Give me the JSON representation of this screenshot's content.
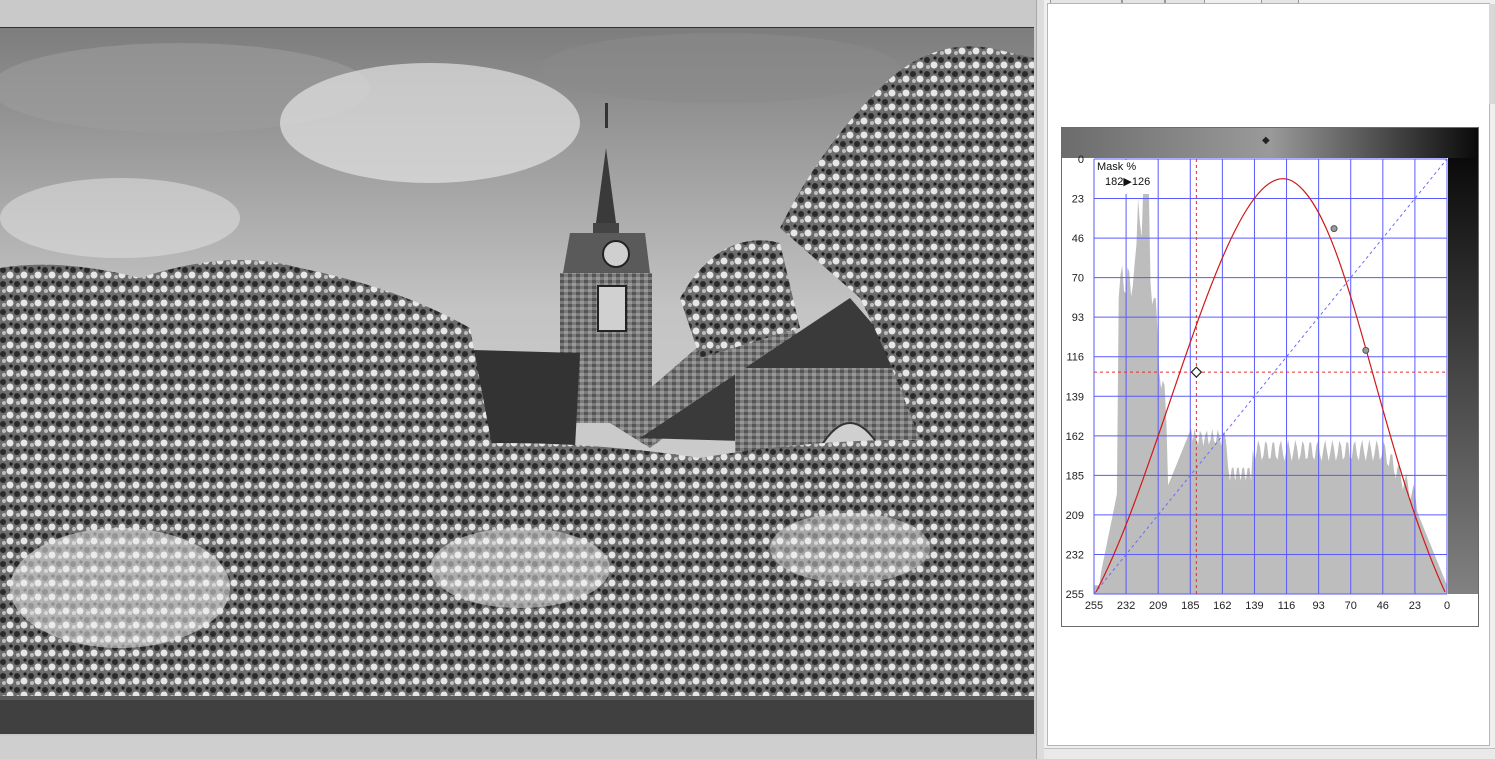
{
  "curves": {
    "mask_label": "Mask",
    "percent_label": "%",
    "readout_in": "182",
    "readout_arrow": "▶",
    "readout_out": "126",
    "top_handle_glyph": "◆",
    "y_ticks": [
      "0",
      "23",
      "46",
      "70",
      "93",
      "116",
      "139",
      "162",
      "185",
      "209",
      "232",
      "255"
    ],
    "x_ticks": [
      "255",
      "232",
      "209",
      "185",
      "162",
      "139",
      "116",
      "93",
      "70",
      "46",
      "23",
      "0"
    ],
    "colors": {
      "curve": "#d01818",
      "grid": "#5a5aff",
      "diagonal": "#6a6aff",
      "histogram": "#bdbdbd",
      "crosshair": "#e03030"
    }
  }
}
